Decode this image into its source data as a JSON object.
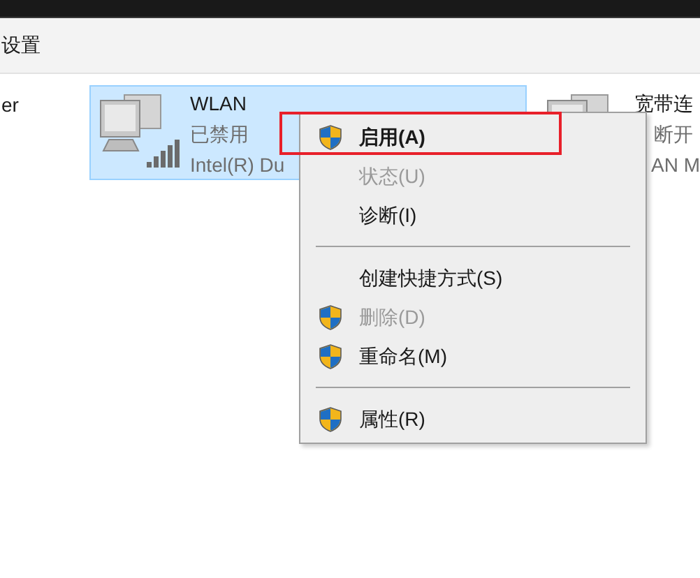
{
  "toolbar": {
    "label": "设置"
  },
  "left_cut": "er",
  "adapters": [
    {
      "name": "WLAN",
      "status": "已禁用",
      "device": "Intel(R) Du",
      "selected": true,
      "kind": "wifi"
    },
    {
      "name": "宽带连",
      "status": "断开",
      "device": "AN M",
      "selected": false,
      "kind": "dialup"
    }
  ],
  "context_menu": {
    "items": [
      {
        "kind": "item",
        "label": "启用(A)",
        "shield": true,
        "disabled": false,
        "default": true
      },
      {
        "kind": "item",
        "label": "状态(U)",
        "shield": false,
        "disabled": true,
        "default": false
      },
      {
        "kind": "item",
        "label": "诊断(I)",
        "shield": false,
        "disabled": false,
        "default": false
      },
      {
        "kind": "separator"
      },
      {
        "kind": "item",
        "label": "创建快捷方式(S)",
        "shield": false,
        "disabled": false,
        "default": false
      },
      {
        "kind": "item",
        "label": "删除(D)",
        "shield": true,
        "disabled": true,
        "default": false
      },
      {
        "kind": "item",
        "label": "重命名(M)",
        "shield": true,
        "disabled": false,
        "default": false
      },
      {
        "kind": "separator"
      },
      {
        "kind": "item",
        "label": "属性(R)",
        "shield": true,
        "disabled": false,
        "default": false
      }
    ]
  }
}
